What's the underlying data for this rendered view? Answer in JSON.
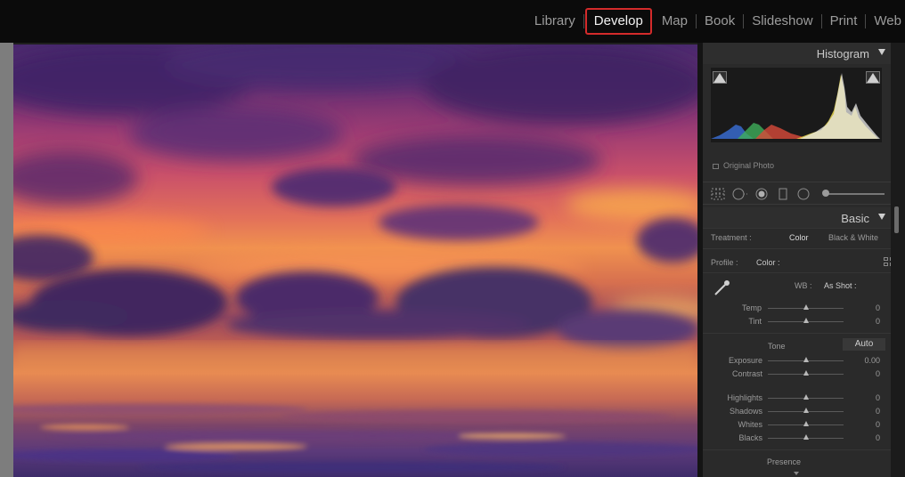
{
  "modules": [
    {
      "label": "Library",
      "active": false
    },
    {
      "label": "Develop",
      "active": true
    },
    {
      "label": "Map",
      "active": false
    },
    {
      "label": "Book",
      "active": false
    },
    {
      "label": "Slideshow",
      "active": false
    },
    {
      "label": "Print",
      "active": false
    },
    {
      "label": "Web",
      "active": false
    }
  ],
  "histogram": {
    "title": "Histogram",
    "original_photo_label": "Original Photo",
    "colors": {
      "blue": "#3a6fd8",
      "green": "#3fae5a",
      "red": "#d84a3a",
      "yellow": "#e9d84a",
      "white": "#e8e8e8"
    }
  },
  "basic": {
    "title": "Basic",
    "treatment": {
      "label": "Treatment :",
      "options": [
        "Color",
        "Black & White"
      ],
      "selected": "Color"
    },
    "profile": {
      "label": "Profile :",
      "value": "Color :"
    },
    "wb": {
      "label": "WB :",
      "value": "As Shot :"
    },
    "tone_label": "Tone",
    "auto_label": "Auto",
    "presence_label": "Presence",
    "sliders": [
      {
        "label": "Temp",
        "value": "0",
        "level": 0.5
      },
      {
        "label": "Tint",
        "value": "0",
        "level": 0.5
      },
      {
        "label": "Exposure",
        "value": "0.00",
        "level": 0.5
      },
      {
        "label": "Contrast",
        "value": "0",
        "level": 0.5
      },
      {
        "label": "Highlights",
        "value": "0",
        "level": 0.5
      },
      {
        "label": "Shadows",
        "value": "0",
        "level": 0.5
      },
      {
        "label": "Whites",
        "value": "0",
        "level": 0.5
      },
      {
        "label": "Blacks",
        "value": "0",
        "level": 0.5
      }
    ]
  },
  "accent_color": "#d42b2b"
}
